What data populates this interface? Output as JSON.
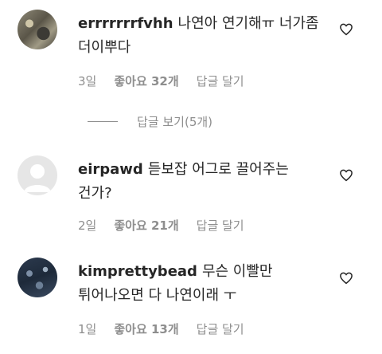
{
  "comments": [
    {
      "username": "errrrrrrfvhh",
      "text": "나연아 연기해ㅠ 너가좀 더이뿌다",
      "time": "3일",
      "likes": "좋아요 32개",
      "reply": "답글 달기"
    },
    {
      "username": "eirpawd",
      "text": "듣보잡 어그로 끌어주는 건가?",
      "time": "2일",
      "likes": "좋아요 21개",
      "reply": "답글 달기"
    },
    {
      "username": "kimprettybead",
      "text": "무슨 이빨만 튀어나오면 다 나연이래 ㅜ",
      "time": "1일",
      "likes": "좋아요 13개",
      "reply": "답글 달기"
    }
  ],
  "view_replies": "답글 보기(5개)",
  "icons": {
    "like": "heart-outline-icon"
  }
}
